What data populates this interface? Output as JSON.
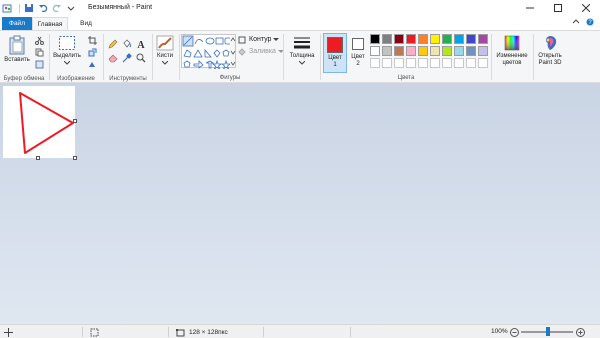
{
  "app": {
    "title": "Безымянный - Paint"
  },
  "tabs": {
    "file": "Файл",
    "home": "Главная",
    "view": "Вид"
  },
  "ribbon": {
    "clipboard": {
      "paste_label": "Вставить",
      "group_label": "Буфер обмена"
    },
    "image": {
      "select_label": "Выделить",
      "group_label": "Изображение"
    },
    "tools": {
      "group_label": "Инструменты"
    },
    "brushes": {
      "label": "Кисти"
    },
    "shapes": {
      "outline_label": "Контур",
      "fill_label": "Заливка",
      "group_label": "Фигуры"
    },
    "size": {
      "label": "Толщина"
    },
    "colors": {
      "color1_label": "Цвет",
      "color1_num": "1",
      "color2_label": "Цвет",
      "color2_num": "2",
      "group_label": "Цвета",
      "color1_value": "#ed1c24",
      "color2_value": "#ffffff",
      "palette_row1": [
        "#000000",
        "#7f7f7f",
        "#880015",
        "#ed1c24",
        "#ff7f27",
        "#fff200",
        "#22b14c",
        "#00a2e8",
        "#3f48cc",
        "#a349a4"
      ],
      "palette_row2": [
        "#ffffff",
        "#c3c3c3",
        "#b97a57",
        "#ffaec9",
        "#ffc90e",
        "#efe4b0",
        "#b5e61d",
        "#99d9ea",
        "#7092be",
        "#c8bfe7"
      ],
      "edit_label_1": "Изменение",
      "edit_label_2": "цветов"
    },
    "paint3d": {
      "label_1": "Открыть",
      "label_2": "Paint 3D"
    }
  },
  "canvas": {
    "shape": "triangle",
    "stroke_color": "#ed1c24"
  },
  "status": {
    "canvas_size": "128 × 128пкс",
    "zoom": "100%",
    "zoom_level": 1.0
  }
}
